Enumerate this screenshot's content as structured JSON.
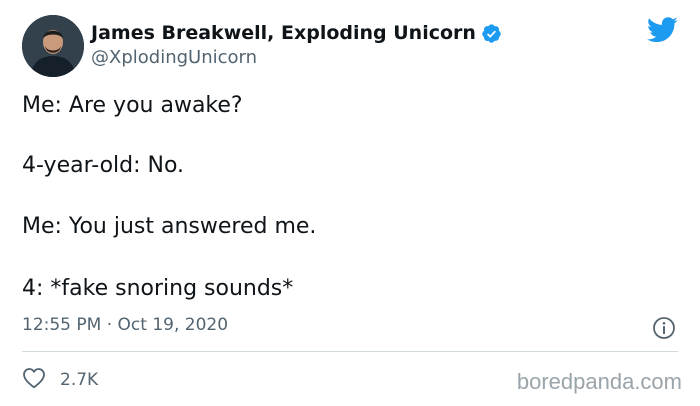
{
  "author": {
    "display_name": "James Breakwell, Exploding Unicorn",
    "handle": "@XplodingUnicorn"
  },
  "icons": {
    "verified": "verified-badge-icon",
    "logo": "twitter-bird-icon",
    "info": "info-icon",
    "like": "heart-icon"
  },
  "colors": {
    "twitter_blue": "#1d9bf0",
    "secondary_text": "#536471"
  },
  "tweet": {
    "lines": [
      "Me: Are you awake?",
      "4-year-old: No.",
      "Me: You just answered me.",
      "4: *fake snoring sounds*"
    ],
    "timestamp": "12:55 PM · Oct 19, 2020"
  },
  "engagement": {
    "likes": "2.7K"
  },
  "watermark": "boredpanda.com"
}
